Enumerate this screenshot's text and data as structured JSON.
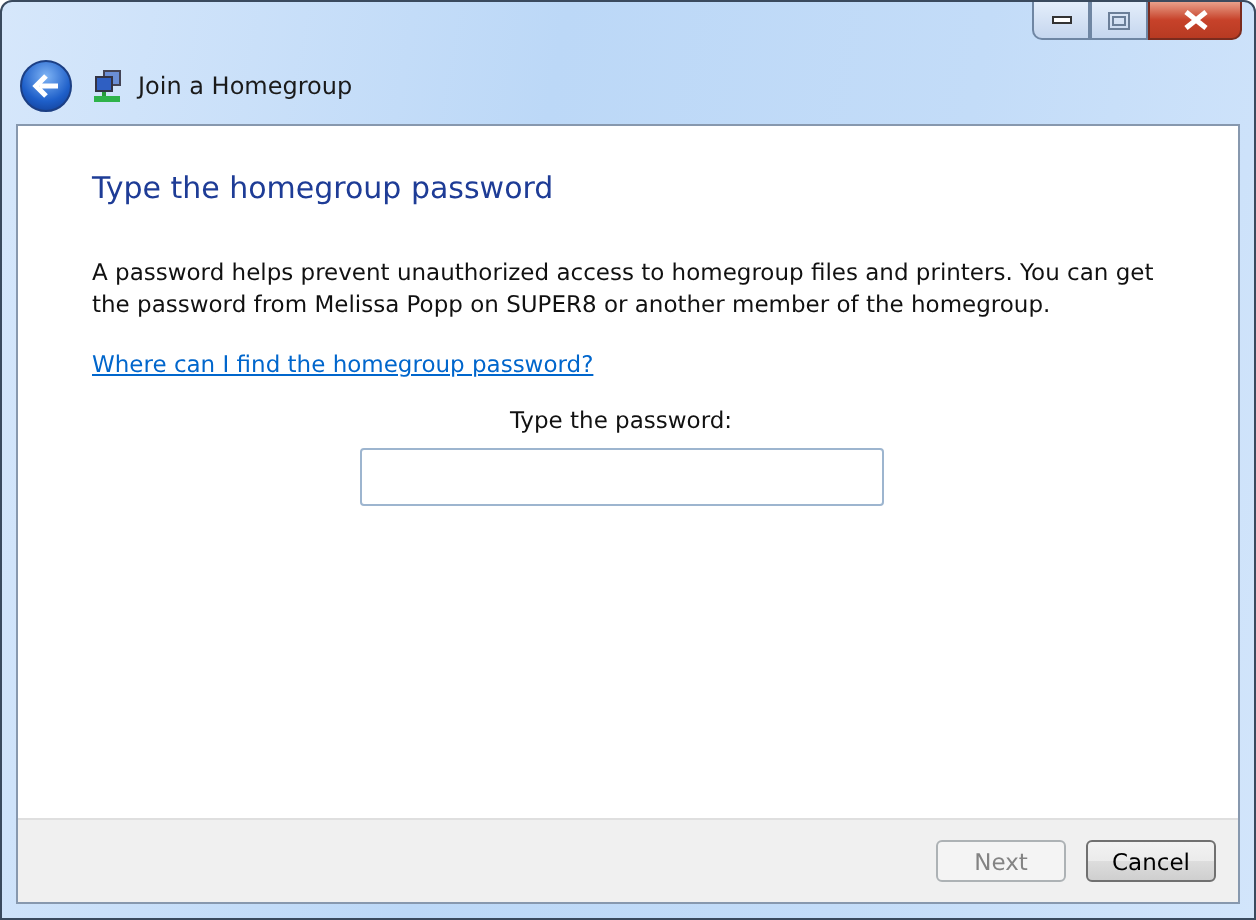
{
  "window": {
    "title": "Join a Homegroup"
  },
  "heading": "Type the homegroup password",
  "description": "A password helps prevent unauthorized access to homegroup files and printers. You can get the password from Melissa Popp on SUPER8 or another member of the homegroup.",
  "help_link": "Where can I find the homegroup password?",
  "password_label": "Type the password:",
  "buttons": [
    {
      "label": "Next",
      "disabled": true
    },
    {
      "label": "Cancel",
      "disabled": false
    }
  ]
}
